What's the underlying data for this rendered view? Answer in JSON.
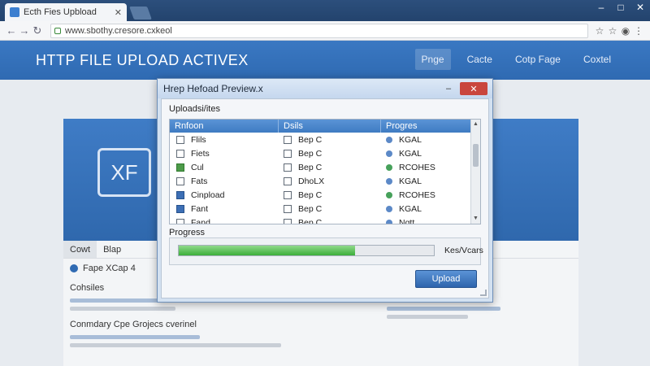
{
  "browser": {
    "tab_title": "Ecth Fies Upbload",
    "url": "www.sbothy.cresore.cxkeol"
  },
  "site": {
    "title": "HTTP FILE UPLOAD ACTIVEX",
    "nav": [
      "Pnge",
      "Cacte",
      "Cotp Fage",
      "Coxtel"
    ],
    "hero_text": "XF",
    "lower_tabs": [
      "Cowt",
      "Blap"
    ],
    "lower_row_text": "Fape  XCap 4",
    "heading_1": "Cohsiles",
    "heading_2": "Conmdary Cpe Grojecs cverinel"
  },
  "dialog": {
    "title": "Hrep Hefoad Preview.x",
    "uploads_label": "Uploadsi/ites",
    "columns": [
      "Rnfoon",
      "Dsils",
      "Progres"
    ],
    "rows": [
      {
        "name": "Flils",
        "details": "Bep C",
        "progress": "KGAL",
        "checked": false
      },
      {
        "name": "Fiets",
        "details": "Bep C",
        "progress": "KGAL",
        "checked": false
      },
      {
        "name": "Cul",
        "details": "Bep C",
        "progress": "RCOHES",
        "checked": true
      },
      {
        "name": "Fats",
        "details": "DhoLX",
        "progress": "KGAL",
        "checked": false
      },
      {
        "name": "Cinpload",
        "details": "Bep C",
        "progress": "RCOHES",
        "checked": true
      },
      {
        "name": "Fant",
        "details": "Bep C",
        "progress": "KGAL",
        "checked": true
      },
      {
        "name": "Fand",
        "details": "Bep C",
        "progress": "Nqtt",
        "checked": false
      }
    ],
    "progress_label": "Progress",
    "progress_fraction": 0.69,
    "progress_status": "Kes/Vcars",
    "upload_label": "Upload"
  },
  "colors": {
    "accent": "#2f6ab2",
    "progress": "#3cae3a",
    "close": "#c9463d"
  }
}
